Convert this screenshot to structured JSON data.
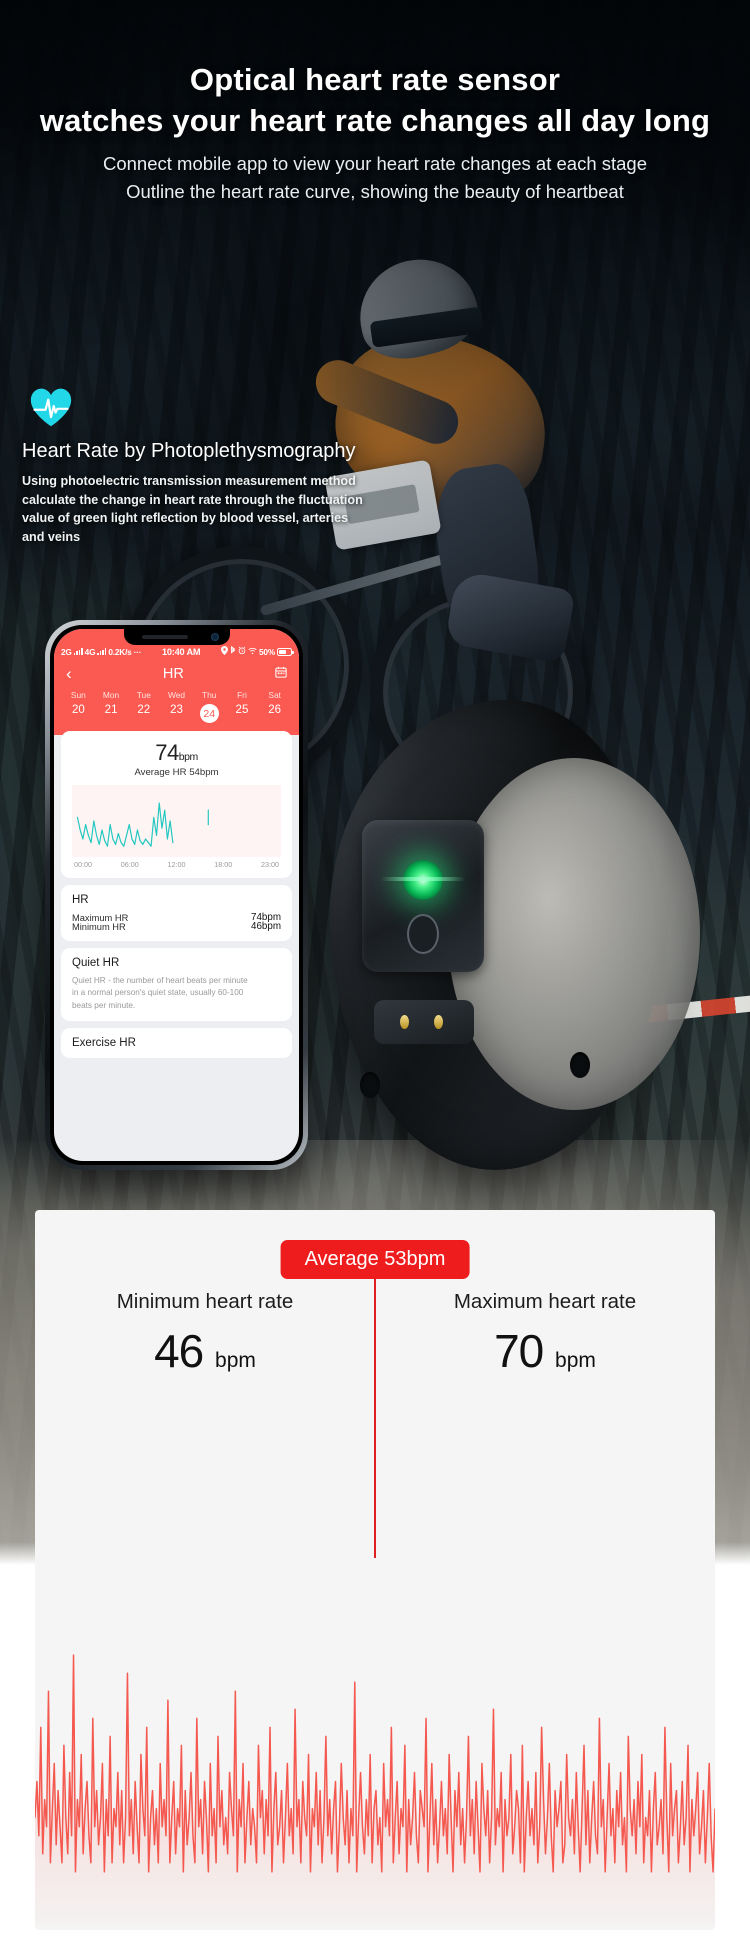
{
  "hero": {
    "title_line1": "Optical heart rate sensor",
    "title_line2": "watches your heart rate changes all day long",
    "sub_line1": "Connect mobile app to view your heart rate changes at each stage",
    "sub_line2": "Outline the heart rate curve, showing the beauty of heartbeat"
  },
  "ppg": {
    "icon": "heart-pulse-icon",
    "heading": "Heart Rate by Photoplethysmography",
    "body_line1": "Using photoelectric transmission measurement method",
    "body_line2": "calculate the change in heart rate through the fluctuation",
    "body_line3": "value of green light reflection by blood vessel, arteries and veins"
  },
  "phone": {
    "statusbar": {
      "net1": "2G",
      "net2": "4G",
      "speed": "0.2K/s",
      "dots": "···",
      "time": "10:40 AM",
      "location_icon": "location-pin-icon",
      "bluetooth_icon": "bluetooth-icon",
      "alarm_icon": "alarm-clock-icon",
      "wifi_icon": "wifi-icon",
      "battery_pct": "50%",
      "battery_icon": "battery-icon"
    },
    "navbar": {
      "back_icon": "chevron-left-icon",
      "title": "HR",
      "calendar_icon": "calendar-icon"
    },
    "week": {
      "days": [
        "Sun",
        "Mon",
        "Tue",
        "Wed",
        "Thu",
        "Fri",
        "Sat"
      ],
      "dates": [
        "20",
        "21",
        "22",
        "23",
        "24",
        "25",
        "26"
      ],
      "selected_index": 4
    },
    "summary_card": {
      "bpm_value": "74",
      "bpm_unit": "bpm",
      "average_line": "Average HR  54bpm",
      "axis": [
        "00:00",
        "06:00",
        "12:00",
        "18:00",
        "23:00"
      ]
    },
    "hr_card": {
      "title": "HR",
      "rows": [
        {
          "label": "Maximum HR",
          "value": "74bpm"
        },
        {
          "label": "Minimum HR",
          "value": "46bpm"
        }
      ]
    },
    "quiet_card": {
      "title": "Quiet HR",
      "desc_line1": "Quiet HR - the number of heart beats per minute",
      "desc_line2": "in a normal person's quiet state, usually 60-100",
      "desc_line3": "beats per minute."
    },
    "exercise_card": {
      "title": "Exercise HR"
    }
  },
  "watch": {
    "led_icon": "green-led-sensor-icon",
    "photodiode_icon": "photodiode-icon",
    "charging_contacts_icon": "charging-contacts-icon"
  },
  "summary": {
    "average_badge": "Average  53bpm",
    "minimum_label": "Minimum heart rate",
    "minimum_value": "46",
    "minimum_unit": "bpm",
    "maximum_label": "Maximum heart rate",
    "maximum_value": "70",
    "maximum_unit": "bpm"
  },
  "colors": {
    "app_red": "#fb5a52",
    "badge_red": "#ee1c1c",
    "wave_red": "#f4584f",
    "mini_chart_teal": "#23c8c0",
    "heart_icon_cyan": "#22d7e8",
    "panel_gray": "#f5f5f5"
  },
  "chart_data": [
    {
      "type": "line",
      "name": "phone-mini-hr-chart",
      "title": "",
      "xlabel": "",
      "ylabel": "",
      "x_ticks": [
        "00:00",
        "06:00",
        "12:00",
        "18:00",
        "23:00"
      ],
      "xlim": [
        0,
        23
      ],
      "ylim": [
        40,
        80
      ],
      "series": [
        {
          "name": "Heart rate",
          "color": "#23c8c0",
          "x": [
            0.6,
            0.9,
            1.2,
            1.5,
            1.8,
            2.1,
            2.4,
            2.7,
            3.0,
            3.3,
            3.6,
            3.9,
            4.2,
            4.5,
            4.8,
            5.1,
            5.4,
            5.7,
            6.0,
            6.3,
            6.6,
            6.9,
            7.2,
            7.5,
            7.8,
            8.1,
            8.4,
            8.7,
            9.0,
            9.3,
            9.6,
            9.9,
            10.2,
            10.5,
            10.8,
            11.1,
            15.0
          ],
          "y": [
            62,
            55,
            50,
            58,
            52,
            48,
            60,
            52,
            47,
            55,
            49,
            46,
            58,
            50,
            47,
            53,
            48,
            46,
            52,
            58,
            50,
            47,
            55,
            49,
            47,
            50,
            48,
            46,
            62,
            52,
            70,
            56,
            66,
            50,
            60,
            48,
            66
          ]
        }
      ]
    },
    {
      "type": "line",
      "name": "bottom-hr-waveform",
      "title": "Average  53bpm",
      "annotations": [
        {
          "text": "Minimum heart rate",
          "value": 46,
          "unit": "bpm"
        },
        {
          "text": "Maximum heart rate",
          "value": 70,
          "unit": "bpm"
        }
      ],
      "ylim": [
        40,
        75
      ],
      "average": 53,
      "minimum": 46,
      "maximum": 70,
      "color": "#f4584f",
      "values": [
        52,
        56,
        50,
        62,
        48,
        54,
        51,
        66,
        47,
        53,
        58,
        49,
        55,
        51,
        47,
        60,
        52,
        48,
        57,
        50,
        70,
        46,
        54,
        51,
        59,
        48,
        53,
        56,
        50,
        47,
        63,
        51,
        55,
        49,
        52,
        58,
        46,
        54,
        50,
        61,
        47,
        53,
        51,
        57,
        49,
        55,
        47,
        52,
        68,
        50,
        54,
        48,
        56,
        51,
        47,
        59,
        53,
        50,
        62,
        46,
        52,
        55,
        49,
        53,
        47,
        58,
        51,
        54,
        50,
        65,
        47,
        52,
        56,
        48,
        53,
        51,
        60,
        46,
        55,
        49,
        52,
        57,
        50,
        47,
        63,
        51,
        54,
        48,
        56,
        52,
        46,
        58,
        50,
        53,
        47,
        61,
        51,
        55,
        49,
        52,
        48,
        57,
        53,
        50,
        66,
        46,
        54,
        51,
        58,
        47,
        52,
        56,
        49,
        53,
        51,
        47,
        60,
        52,
        55,
        48,
        54,
        50,
        62,
        46,
        53,
        57,
        49,
        51,
        55,
        47,
        52,
        58,
        50,
        53,
        48,
        64,
        51,
        54,
        47,
        56,
        52,
        50,
        59,
        46,
        53,
        51,
        57,
        49,
        55,
        47,
        52,
        61,
        50,
        54,
        48,
        53,
        56,
        46,
        51,
        58,
        52,
        49,
        55,
        47,
        53,
        50,
        67,
        46,
        52,
        57,
        51,
        48,
        54,
        50,
        59,
        47,
        53,
        55,
        49,
        52,
        46,
        58,
        51,
        54,
        50,
        62,
        47,
        52,
        56,
        48,
        53,
        51,
        60,
        46,
        54,
        49,
        52,
        57,
        50,
        47,
        55,
        53,
        51,
        63,
        46,
        52,
        58,
        49,
        54,
        47,
        51,
        56,
        50,
        53,
        48,
        59,
        52,
        46,
        55,
        51,
        57,
        49,
        53,
        47,
        52,
        61,
        50,
        54,
        48,
        56,
        51,
        46,
        58,
        53,
        50,
        55,
        47,
        52,
        64,
        49,
        53,
        51,
        57,
        46,
        54,
        50,
        52,
        59,
        48,
        51,
        55,
        53,
        47,
        60,
        46,
        52,
        56,
        50,
        53,
        49,
        57,
        47,
        51,
        62,
        54,
        48,
        52,
        58,
        50,
        46,
        55,
        51,
        53,
        56,
        47,
        49,
        59,
        52,
        50,
        54,
        48,
        57,
        51,
        46,
        53,
        60,
        49,
        55,
        47,
        52,
        56,
        50,
        48,
        63,
        51,
        54,
        46,
        52,
        58,
        50,
        53,
        47,
        55,
        51,
        57,
        49,
        52,
        46,
        61,
        53,
        50,
        54,
        48,
        56,
        51,
        59,
        47,
        52,
        50,
        55,
        46,
        53,
        57,
        49,
        51,
        54,
        48,
        62,
        52,
        46,
        58,
        50,
        53,
        55,
        47,
        51,
        56,
        49,
        52,
        60,
        46,
        54,
        50,
        53,
        57,
        48,
        51,
        55,
        47,
        52,
        58,
        50,
        46,
        53
      ]
    }
  ]
}
